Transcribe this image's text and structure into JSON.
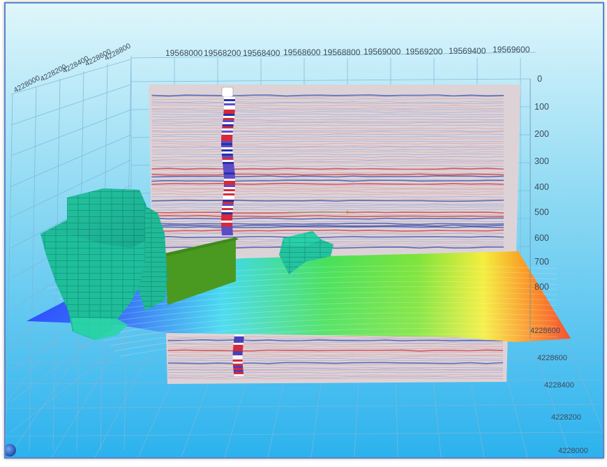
{
  "viewer": {
    "x_axis_ticks": [
      "19568000",
      "19568200",
      "19568400",
      "19568600",
      "19568800",
      "19569000",
      "19569200",
      "19569400",
      "19569600"
    ],
    "y_axis_ticks_top": [
      "4228000",
      "4228200",
      "4228400",
      "4228600",
      "4228800"
    ],
    "depth_ticks": [
      "0",
      "100",
      "200",
      "300",
      "400",
      "500",
      "600",
      "700",
      "800"
    ],
    "y_axis_ticks_right": [
      "4228600",
      "4228400",
      "4228200",
      "4228000"
    ],
    "colors": {
      "background_top": "#d9f4fb",
      "background_bottom": "#2fb4ee",
      "seismic_base": "#dcd2d6",
      "geobody": "#1fb99b",
      "fault_plane": "#4c9a23"
    },
    "objects": [
      "seismic-section",
      "well-log",
      "horizon-surface",
      "geobody-large",
      "geobody-small",
      "fault-plane"
    ]
  }
}
